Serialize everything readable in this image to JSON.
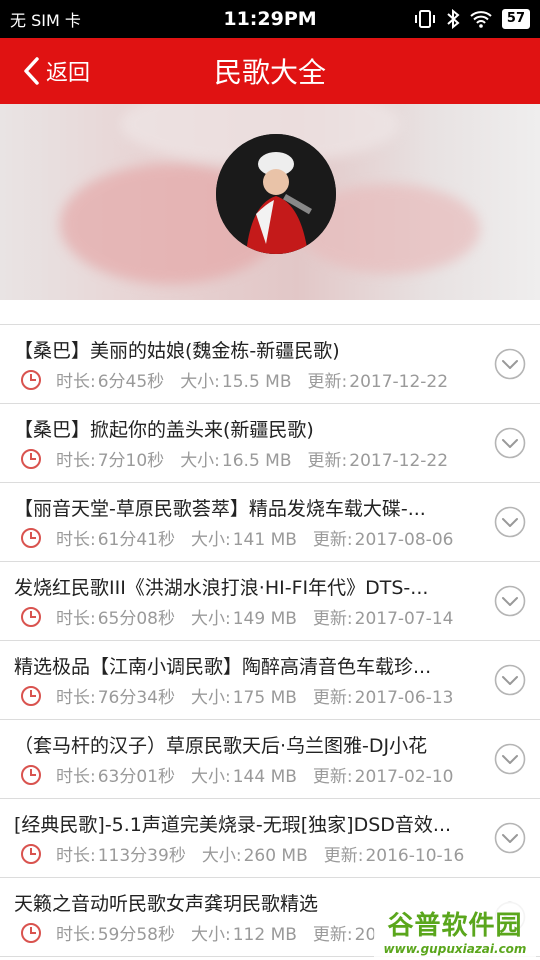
{
  "status": {
    "carrier": "无 SIM 卡",
    "time": "11:29PM",
    "battery": "57"
  },
  "header": {
    "back_label": "返回",
    "title": "民歌大全"
  },
  "colors": {
    "accent": "#e01212",
    "meta": "#9a9a9a",
    "clock": "#d9534f"
  },
  "meta_labels": {
    "duration": "时长:",
    "size": "大小:",
    "updated": "更新:"
  },
  "songs": [
    {
      "title": "【桑巴】美丽的姑娘(魏金栋-新疆民歌)",
      "duration": "6分45秒",
      "size": "15.5 MB",
      "updated": "2017-12-22"
    },
    {
      "title": "【桑巴】掀起你的盖头来(新疆民歌)",
      "duration": "7分10秒",
      "size": "16.5 MB",
      "updated": "2017-12-22"
    },
    {
      "title": "【丽音天堂-草原民歌荟萃】精品发烧车载大碟-...",
      "duration": "61分41秒",
      "size": "141 MB",
      "updated": "2017-08-06"
    },
    {
      "title": "发烧红民歌III《洪湖水浪打浪·HI-FI年代》DTS-...",
      "duration": "65分08秒",
      "size": "149 MB",
      "updated": "2017-07-14"
    },
    {
      "title": "精选极品【江南小调民歌】陶醉高清音色车载珍...",
      "duration": "76分34秒",
      "size": "175 MB",
      "updated": "2017-06-13"
    },
    {
      "title": "（套马杆的汉子）草原民歌天后·乌兰图雅-DJ小花",
      "duration": "63分01秒",
      "size": "144 MB",
      "updated": "2017-02-10"
    },
    {
      "title": "[经典民歌]-5.1声道完美烧录-无瑕[独家]DSD音效...",
      "duration": "113分39秒",
      "size": "260 MB",
      "updated": "2016-10-16"
    },
    {
      "title": "天籁之音动听民歌女声龚玥民歌精选",
      "duration": "59分58秒",
      "size": "112 MB",
      "updated": "20"
    }
  ],
  "watermark": {
    "name": "谷普软件园",
    "url": "www.gupuxiazai.com"
  }
}
